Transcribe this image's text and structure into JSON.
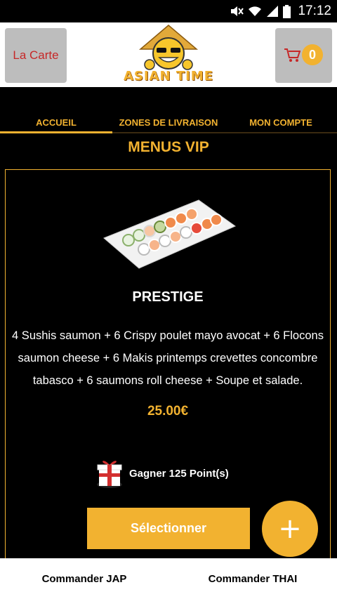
{
  "status_bar": {
    "time": "17:12"
  },
  "header": {
    "menu_button_label": "La Carte",
    "logo_text": "ASIAN TIME",
    "cart_count": "0"
  },
  "nav": {
    "tabs": [
      {
        "label": "ACCUEIL",
        "active": true
      },
      {
        "label": "ZONES DE LIVRAISON",
        "active": false
      },
      {
        "label": "MON COMPTE",
        "active": false
      }
    ]
  },
  "section_title": "MENUS VIP",
  "product": {
    "name": "PRESTIGE",
    "description": "4 Sushis saumon + 6 Crispy poulet mayo avocat + 6 Flocons saumon cheese + 6 Makis printemps crevettes concombre tabasco + 6 saumons roll cheese + Soupe et salade.",
    "price": "25.00€",
    "points_text": "Gagner 125 Point(s)",
    "select_label": "Sélectionner",
    "add_label": "+"
  },
  "bottom_bar": {
    "left_label": "Commander JAP",
    "right_label": "Commander THAI"
  },
  "colors": {
    "accent": "#f2b230",
    "background": "#000000",
    "menu_button_text": "#c62828",
    "header_button_bg": "#bdbdbd"
  },
  "icons": [
    "wifi-icon",
    "signal-icon",
    "battery-icon",
    "mute-icon",
    "cart-icon",
    "gift-icon",
    "logo-mascot"
  ]
}
